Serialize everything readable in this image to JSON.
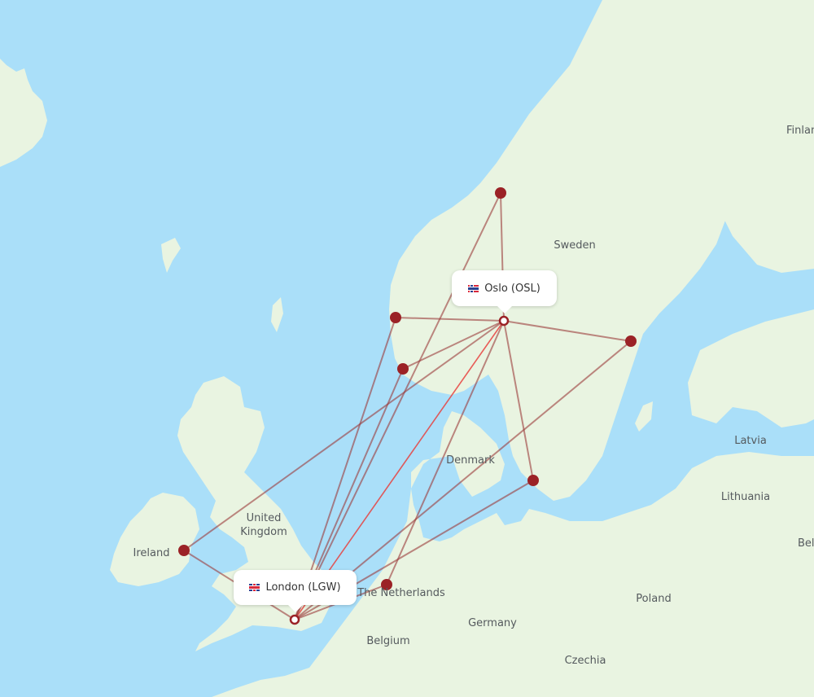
{
  "map": {
    "colors": {
      "water": "#aadff9",
      "land": "#e9f4e1",
      "land_alt": "#e4f0da",
      "border": "#8fcf8f",
      "route": "#9b3a3a",
      "route_highlight": "#e8423f",
      "airport_dot": "#9b2226"
    },
    "country_labels": [
      {
        "name": "Sweden"
      },
      {
        "name": "Finland"
      },
      {
        "name": "Latvia"
      },
      {
        "name": "Lithuania"
      },
      {
        "name": "Denmark"
      },
      {
        "name": "United"
      },
      {
        "name": "Kingdom"
      },
      {
        "name": "Ireland"
      },
      {
        "name": "The Netherlands"
      },
      {
        "name": "Belgium"
      },
      {
        "name": "Germany"
      },
      {
        "name": "Poland"
      },
      {
        "name": "Czechia"
      },
      {
        "name": "Bel"
      }
    ],
    "origin": {
      "city": "London",
      "code": "LGW",
      "label": "London (LGW)",
      "flag": "gb-flag"
    },
    "destination": {
      "city": "Oslo",
      "code": "OSL",
      "label": "Oslo (OSL)",
      "flag": "no-flag"
    },
    "airports": [
      {
        "id": "trondheim",
        "hub": false
      },
      {
        "id": "bergen",
        "hub": false
      },
      {
        "id": "stavanger",
        "hub": false
      },
      {
        "id": "stockholm",
        "hub": false
      },
      {
        "id": "copenhagen",
        "hub": false
      },
      {
        "id": "amsterdam",
        "hub": false
      },
      {
        "id": "dublin",
        "hub": false
      },
      {
        "id": "oslo",
        "hub": true
      },
      {
        "id": "london",
        "hub": true
      }
    ],
    "routes": [
      {
        "from": "london",
        "to": "oslo",
        "highlight": true
      },
      {
        "from": "london",
        "to": "bergen",
        "highlight": false
      },
      {
        "from": "london",
        "to": "stavanger",
        "highlight": false
      },
      {
        "from": "london",
        "to": "trondheim",
        "highlight": false
      },
      {
        "from": "london",
        "to": "stockholm",
        "highlight": false
      },
      {
        "from": "london",
        "to": "copenhagen",
        "highlight": false
      },
      {
        "from": "london",
        "to": "amsterdam",
        "highlight": false
      },
      {
        "from": "london",
        "to": "dublin",
        "highlight": false
      },
      {
        "from": "oslo",
        "to": "trondheim",
        "highlight": false
      },
      {
        "from": "oslo",
        "to": "bergen",
        "highlight": false
      },
      {
        "from": "oslo",
        "to": "stavanger",
        "highlight": false
      },
      {
        "from": "oslo",
        "to": "stockholm",
        "highlight": false
      },
      {
        "from": "oslo",
        "to": "copenhagen",
        "highlight": false
      },
      {
        "from": "oslo",
        "to": "amsterdam",
        "highlight": false
      },
      {
        "from": "oslo",
        "to": "dublin",
        "highlight": false
      }
    ]
  }
}
